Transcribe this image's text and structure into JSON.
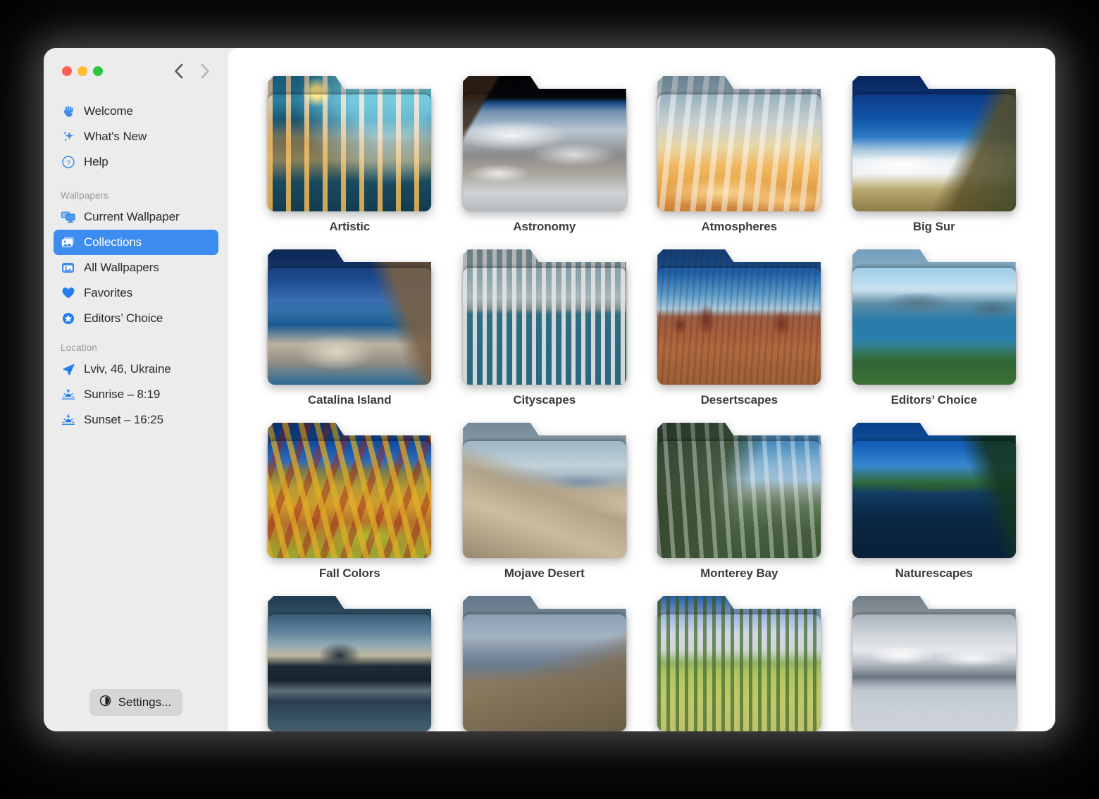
{
  "window": {
    "traffic_lights": [
      {
        "name": "close",
        "color": "#ff5f57"
      },
      {
        "name": "minimize",
        "color": "#febc2e"
      },
      {
        "name": "maximize",
        "color": "#28c840"
      }
    ],
    "nav": {
      "back": "back-chevron",
      "forward": "forward-chevron"
    },
    "accent_color": "#3d8cf0"
  },
  "sidebar": {
    "top_items": [
      {
        "label": "Welcome",
        "icon": "waving-hand-icon"
      },
      {
        "label": "What's New",
        "icon": "sparkles-icon"
      },
      {
        "label": "Help",
        "icon": "question-circle-icon"
      }
    ],
    "wallpapers_header": "Wallpapers",
    "wallpaper_items": [
      {
        "label": "Current Wallpaper",
        "icon": "displays-icon",
        "selected": false
      },
      {
        "label": "Collections",
        "icon": "photo-stack-icon",
        "selected": true
      },
      {
        "label": "All Wallpapers",
        "icon": "photo-archive-icon",
        "selected": false
      },
      {
        "label": "Favorites",
        "icon": "heart-icon",
        "selected": false
      },
      {
        "label": "Editors’ Choice",
        "icon": "star-badge-icon",
        "selected": false
      }
    ],
    "location_header": "Location",
    "location_items": [
      {
        "label": "Lviv, 46, Ukraine",
        "icon": "location-arrow-icon"
      },
      {
        "label": "Sunrise – 8:19",
        "icon": "sunrise-icon"
      },
      {
        "label": "Sunset – 16:25",
        "icon": "sunset-icon"
      }
    ],
    "settings_label": "Settings...",
    "settings_icon": "gear-icon"
  },
  "collections": [
    {
      "label": "Artistic",
      "art": "art-artistic"
    },
    {
      "label": "Astronomy",
      "art": "art-astronomy"
    },
    {
      "label": "Atmospheres",
      "art": "art-atmospheres"
    },
    {
      "label": "Big Sur",
      "art": "art-bigsur"
    },
    {
      "label": "Catalina Island",
      "art": "art-catalina"
    },
    {
      "label": "Cityscapes",
      "art": "art-cityscapes"
    },
    {
      "label": "Desertscapes",
      "art": "art-desertscapes"
    },
    {
      "label": "Editors’ Choice",
      "art": "art-editors"
    },
    {
      "label": "Fall Colors",
      "art": "art-fall"
    },
    {
      "label": "Mojave Desert",
      "art": "art-mojave"
    },
    {
      "label": "Monterey Bay",
      "art": "art-monterey"
    },
    {
      "label": "Naturescapes",
      "art": "art-naturescapes"
    },
    {
      "label": "",
      "art": "art-mountain"
    },
    {
      "label": "",
      "art": "art-hills"
    },
    {
      "label": "",
      "art": "art-watercolor"
    },
    {
      "label": "",
      "art": "art-glacier"
    }
  ]
}
